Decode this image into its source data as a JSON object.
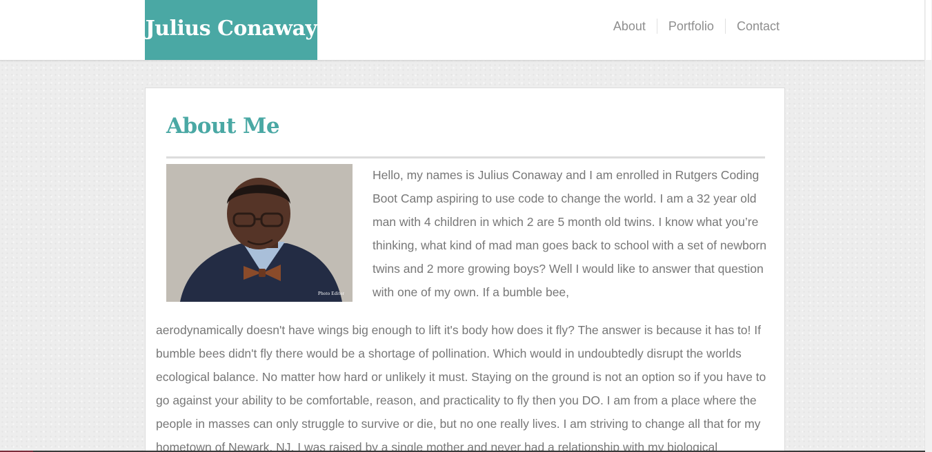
{
  "header": {
    "brand": "Julius Conaway",
    "nav": [
      "About",
      "Portfolio",
      "Contact"
    ]
  },
  "about": {
    "title": "About Me",
    "photo_watermark": "Photo Editor",
    "paragraph_first": "Hello, my names is Julius Conaway and I am enrolled in Rutgers Coding Boot Camp aspiring to use code to change the world. I am a 32 year old man with 4 children in which 2 are 5 month old twins. I know what you’re thinking, what kind of mad man goes back to school with a set of newborn twins and 2 more growing boys? Well I would like to answer that question with one of my own. If a bumble bee,",
    "paragraph_rest": "aerodynamically doesn't have wings big enough to lift it's body how does it fly? The answer is because it has to! If bumble bees didn't fly there would be a shortage of pollination. Which would in undoubtedly disrupt the worlds ecological balance. No matter how hard or unlikely it must. Staying on the ground is not an option so if you have to go against your ability to be comfortable, reason, and practicality to fly then you DO. I am from a place where the people in masses can only struggle to survive or die, but no one really lives. I am striving to change all that for my hometown of Newark, NJ. I was raised by a single mother and never had a relationship with my biological"
  },
  "colors": {
    "accent": "#4aa8a4",
    "text": "#777777",
    "nav_text": "#8e8e8e",
    "page_background": "#ededed"
  }
}
